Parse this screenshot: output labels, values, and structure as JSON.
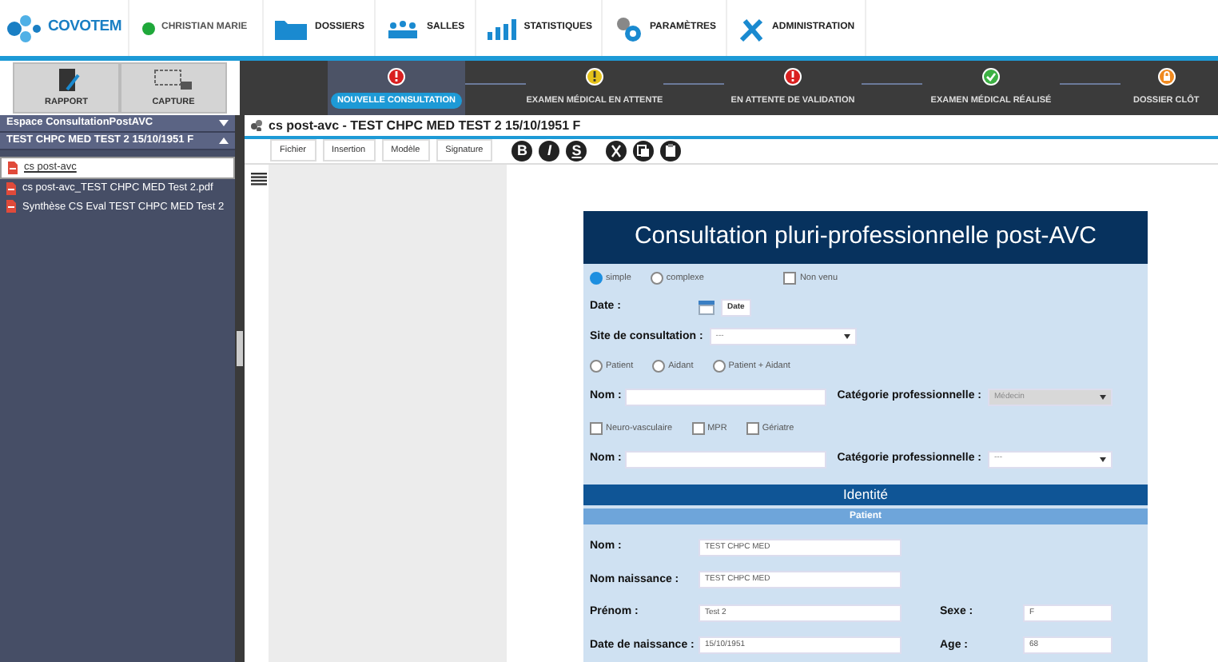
{
  "header": {
    "logo": "COVOTEM",
    "user": {
      "name": "CHRISTIAN MARIE",
      "online": true
    },
    "nav": [
      {
        "label": "DOSSIERS"
      },
      {
        "label": "SALLES"
      },
      {
        "label": "STATISTIQUES"
      },
      {
        "label": "PARAMÈTRES"
      },
      {
        "label": "ADMINISTRATION"
      }
    ]
  },
  "tools": [
    {
      "label": "RAPPORT"
    },
    {
      "label": "CAPTURE"
    }
  ],
  "workflow": [
    {
      "label": "NOUVELLE CONSULTATION",
      "kind": "alert",
      "selected": true
    },
    {
      "label": "EXAMEN MÉDICAL EN ATTENTE",
      "kind": "waiting",
      "selected": false
    },
    {
      "label": "EN ATTENTE DE VALIDATION",
      "kind": "alert",
      "selected": false
    },
    {
      "label": "EXAMEN MÉDICAL RÉALISÉ",
      "kind": "done",
      "selected": false
    },
    {
      "label": "DOSSIER CLÔT",
      "kind": "locked",
      "selected": false
    }
  ],
  "sidebar": {
    "sections": [
      {
        "title": "Espace ConsultationPostAVC",
        "expanded": false
      },
      {
        "title": "TEST CHPC MED TEST 2 15/10/1951 F",
        "expanded": true
      }
    ],
    "items": [
      {
        "label": "cs post-avc",
        "selected": true
      },
      {
        "label": "cs post-avc_TEST CHPC MED Test 2.pdf",
        "selected": false
      },
      {
        "label": "Synthèse CS Eval TEST CHPC MED Test 2",
        "selected": false
      }
    ]
  },
  "document": {
    "title": "cs post-avc - TEST CHPC MED TEST 2 15/10/1951 F",
    "menus": [
      "Fichier",
      "Insertion",
      "Modèle",
      "Signature"
    ],
    "format_buttons": [
      "B",
      "I",
      "S"
    ]
  },
  "form": {
    "title": "Consultation pluri-professionnelle post-AVC",
    "rows": [
      {
        "kind": "choice",
        "options": [
          {
            "label": "simple",
            "kind": "radio",
            "checked": true
          },
          {
            "label": "complexe",
            "kind": "radio",
            "checked": false
          },
          {
            "label": "Non venu",
            "kind": "checkbox",
            "checked": false
          }
        ]
      },
      {
        "kind": "date",
        "label": "Date :",
        "button": "Date"
      },
      {
        "kind": "select",
        "label": "Site de consultation :",
        "value": "---"
      },
      {
        "kind": "choice",
        "options": [
          {
            "label": "Patient",
            "kind": "radio",
            "checked": false
          },
          {
            "label": "Aidant",
            "kind": "radio",
            "checked": false
          },
          {
            "label": "Patient + Aidant",
            "kind": "radio",
            "checked": false
          }
        ]
      },
      {
        "kind": "name_category",
        "label": "Nom :",
        "category_label": "Catégorie professionnelle :",
        "category_value": "Médecin",
        "disabled": true
      },
      {
        "kind": "choice",
        "options": [
          {
            "label": "Neuro-vasculaire",
            "kind": "checkbox",
            "checked": false
          },
          {
            "label": "MPR",
            "kind": "checkbox",
            "checked": false
          },
          {
            "label": "Gériatre",
            "kind": "checkbox",
            "checked": false
          }
        ]
      },
      {
        "kind": "name_category",
        "label": "Nom :",
        "category_label": "Catégorie professionnelle :",
        "category_value": "---",
        "disabled": false
      },
      {
        "kind": "section",
        "label": "Identité"
      },
      {
        "kind": "subsection",
        "label": "Patient"
      },
      {
        "kind": "field",
        "label": "Nom :",
        "value": "TEST CHPC MED"
      },
      {
        "kind": "field",
        "label": "Nom naissance :",
        "value": "TEST CHPC MED"
      },
      {
        "kind": "field",
        "label": "Prénom :",
        "value": "Test 2",
        "label2": "Sexe :",
        "value2": "F"
      },
      {
        "kind": "field",
        "label": "Date de naissance :",
        "value": "15/10/1951",
        "label2": "Age :",
        "value2": "68"
      }
    ]
  }
}
